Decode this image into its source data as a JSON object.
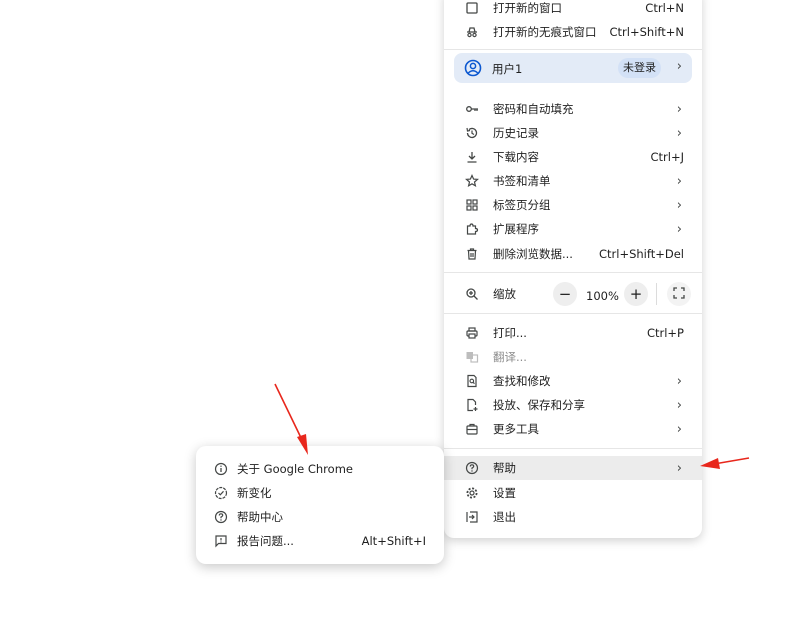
{
  "menu": {
    "top_items": [
      {
        "label": "打开新的窗口",
        "shortcut": "Ctrl+N",
        "icon": "new-window-icon"
      },
      {
        "label": "打开新的无痕式窗口",
        "shortcut": "Ctrl+Shift+N",
        "icon": "incognito-icon"
      }
    ],
    "profile": {
      "label": "用户1",
      "badge": "未登录",
      "icon": "account-circle-icon"
    },
    "items": [
      {
        "label": "密码和自动填充",
        "icon": "key-icon",
        "chevron": true
      },
      {
        "label": "历史记录",
        "icon": "history-icon",
        "chevron": true
      },
      {
        "label": "下载内容",
        "icon": "download-icon",
        "shortcut": "Ctrl+J"
      },
      {
        "label": "书签和清单",
        "icon": "star-icon",
        "chevron": true
      },
      {
        "label": "标签页分组",
        "icon": "tab-groups-icon",
        "chevron": true
      },
      {
        "label": "扩展程序",
        "icon": "puzzle-icon",
        "chevron": true
      },
      {
        "label": "删除浏览数据...",
        "icon": "trash-icon",
        "shortcut": "Ctrl+Shift+Del"
      }
    ],
    "zoom": {
      "label": "缩放",
      "minus": "−",
      "value": "100%",
      "plus": "+",
      "icon": "zoom-icon"
    },
    "tools": [
      {
        "label": "打印...",
        "icon": "print-icon",
        "shortcut": "Ctrl+P"
      },
      {
        "label": "翻译...",
        "icon": "translate-icon",
        "disabled": true
      },
      {
        "label": "查找和修改",
        "icon": "find-icon",
        "chevron": true
      },
      {
        "label": "投放、保存和分享",
        "icon": "cast-save-icon",
        "chevron": true
      },
      {
        "label": "更多工具",
        "icon": "toolbox-icon",
        "chevron": true
      }
    ],
    "bottom": [
      {
        "label": "帮助",
        "icon": "help-icon",
        "chevron": true,
        "highlighted": true
      },
      {
        "label": "设置",
        "icon": "gear-icon"
      },
      {
        "label": "退出",
        "icon": "exit-icon"
      }
    ]
  },
  "help_submenu": [
    {
      "label": "关于 Google Chrome",
      "icon": "info-icon"
    },
    {
      "label": "新变化",
      "icon": "whats-new-icon"
    },
    {
      "label": "帮助中心",
      "icon": "help-icon"
    },
    {
      "label": "报告问题...",
      "icon": "feedback-icon",
      "shortcut": "Alt+Shift+I"
    }
  ],
  "annotation_color": "#e8271c"
}
